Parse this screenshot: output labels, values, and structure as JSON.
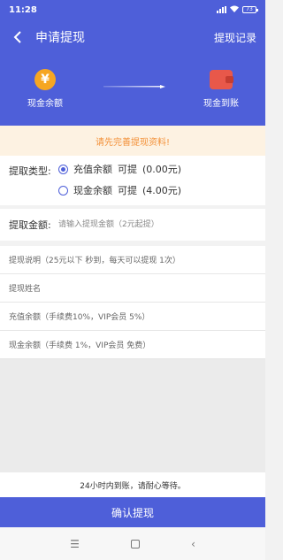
{
  "status": {
    "time": "11:28",
    "battery": "73"
  },
  "header": {
    "title": "申请提现",
    "record_label": "提现记录"
  },
  "flow": {
    "from_label": "现金余额",
    "to_label": "现金到账",
    "coin_symbol": "¥"
  },
  "notice": "请先完善提现资料!",
  "withdraw_type": {
    "label": "提取类型:",
    "options": [
      {
        "name": "充值余额",
        "action": "可提",
        "amount": "(0.00元)",
        "selected": true
      },
      {
        "name": "现金余额",
        "action": "可提",
        "amount": "(4.00元)",
        "selected": false
      }
    ]
  },
  "amount": {
    "label": "提取金额:",
    "placeholder": "请输入提现金额（2元起提）"
  },
  "info_rows": [
    "提现说明（25元以下 秒到，每天可以提现 1次）",
    "提现姓名",
    "充值余额（手续费10%，VIP会员 5%）",
    "现金余额（手续费 1%，VIP会员 免费）"
  ],
  "tip": "24小时内到账，请耐心等待。",
  "confirm_label": "确认提现",
  "system_nav": {
    "menu_icon": "menu-icon",
    "home_icon": "home-square-icon",
    "back_icon": "back-triangle-icon"
  },
  "colors": {
    "primary": "#4e5fd9",
    "notice_text": "#f3923b",
    "notice_bg": "#fdf2e2",
    "coin": "#f6a623",
    "wallet": "#e8584a"
  }
}
